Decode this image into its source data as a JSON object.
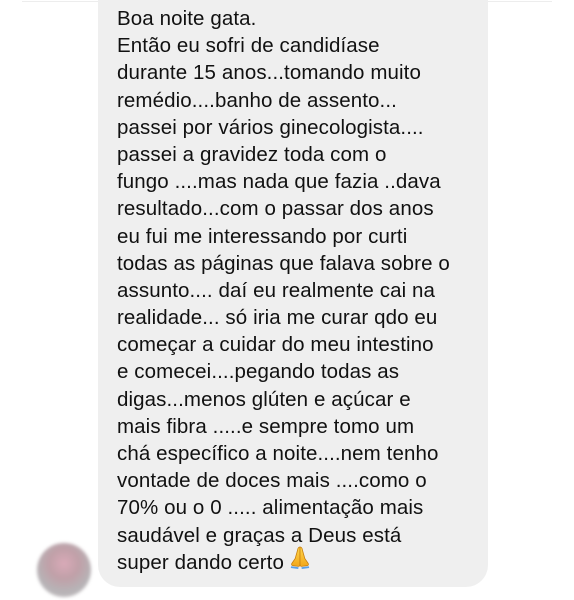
{
  "chat": {
    "message": {
      "lines": [
        "Boa noite gata.",
        "Então eu sofri de candidíase",
        "durante 15 anos...tomando muito",
        "remédio....banho de assento...",
        "passei por vários ginecologista....",
        "passei a gravidez toda com o",
        "fungo ....mas nada que fazia ..dava",
        "resultado...com o passar dos anos",
        "eu fui me interessando por curti",
        "todas as páginas que falava sobre o",
        "assunto.... daí eu realmente cai na",
        "realidade... só iria me curar qdo eu",
        "começar a cuidar do meu intestino",
        "e comecei....pegando todas as",
        "digas...menos glúten e açúcar e",
        "mais fibra .....e sempre tomo um",
        "chá específico a noite....nem tenho",
        "vontade de doces mais ....como o",
        "70% ou o 0 ..... alimentação mais",
        "saudável e graças a Deus está",
        "super dando certo"
      ],
      "emoji": "folded-hands-icon",
      "bubble_color": "#efefef",
      "text_color": "#111111"
    },
    "sender": {
      "avatar": "blurred-avatar"
    }
  }
}
